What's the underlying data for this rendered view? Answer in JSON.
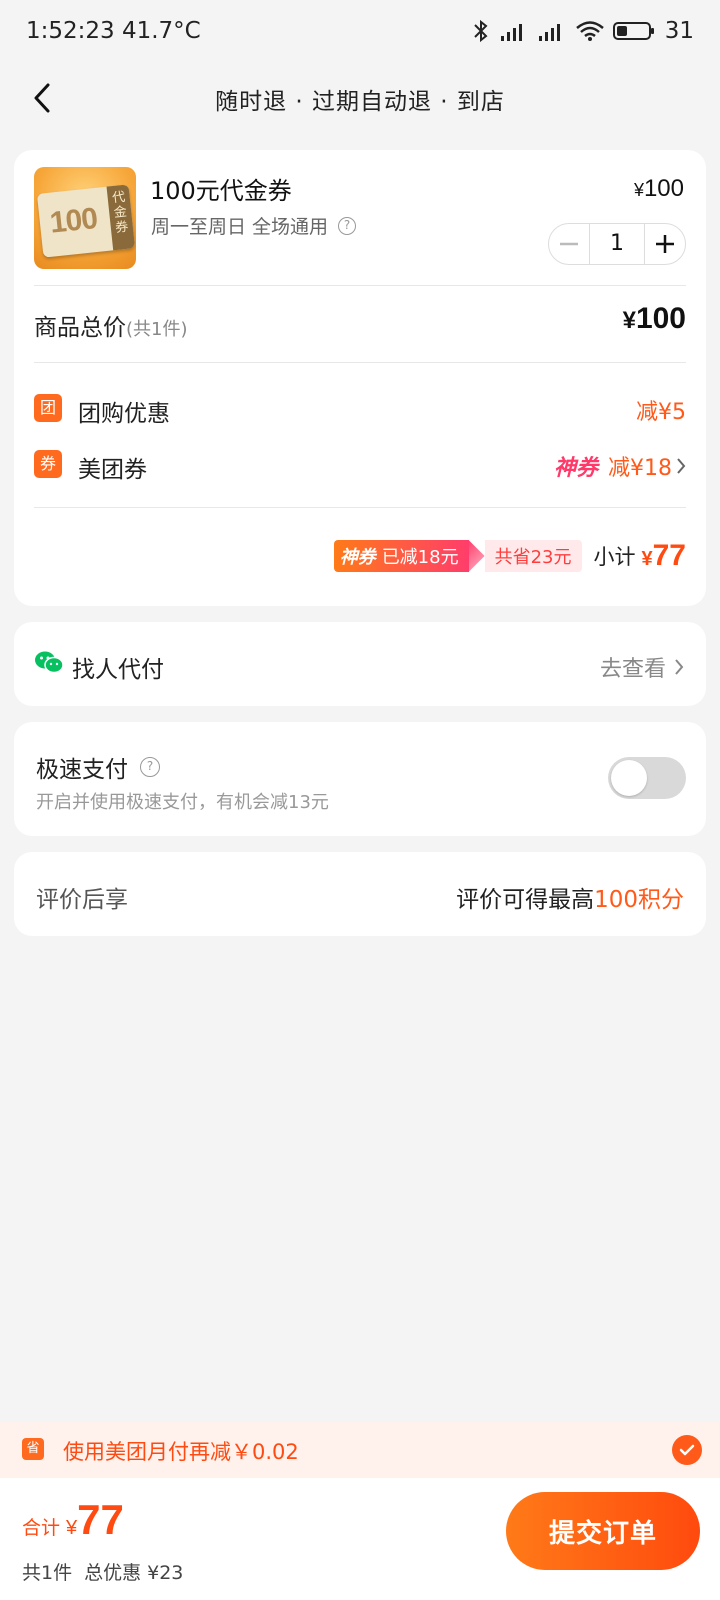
{
  "status_bar": {
    "time_temp": "1:52:23 41.7°C",
    "battery": "31"
  },
  "nav": {
    "title": "随时退 · 过期自动退 · 到店"
  },
  "product": {
    "thumb_number": "100",
    "thumb_tag": "代金券",
    "title": "100元代金券",
    "subtitle": "周一至周日 全场通用",
    "price_symbol": "¥",
    "price": "100",
    "quantity": "1"
  },
  "totals": {
    "label": "商品总价",
    "count": "(共1件)",
    "price_symbol": "¥",
    "price": "100"
  },
  "discounts": [
    {
      "badge": "团",
      "label": "团购优惠",
      "value": "减¥5"
    },
    {
      "badge": "券",
      "label": "美团券",
      "logo": "神券",
      "value": "减¥18"
    }
  ],
  "subtotal": {
    "shen_logo": "神券",
    "reduced_text": "已减18元",
    "saved_text": "共省23元",
    "label": "小计",
    "symbol": "¥",
    "value": "77"
  },
  "friend_pay": {
    "label": "找人代付",
    "link": "去查看"
  },
  "fast_pay": {
    "title": "极速支付",
    "subtitle": "开启并使用极速支付，有机会减13元",
    "enabled": false
  },
  "review": {
    "label": "评价后享",
    "value_prefix": "评价可得最高",
    "value_highlight": "100积分"
  },
  "promo": {
    "icon": "省",
    "text": "使用美团月付再减￥0.02",
    "checked": true
  },
  "bottom": {
    "sum_label": "合计",
    "sum_symbol": "¥",
    "sum_value": "77",
    "item_count": "共1件",
    "total_discount": "总优惠 ¥23",
    "submit_label": "提交订单"
  },
  "colors": {
    "accent": "#ff5a1a",
    "shen_pink": "#ff3a6a",
    "wechat_green": "#07c160",
    "background": "#f4f4f4"
  }
}
